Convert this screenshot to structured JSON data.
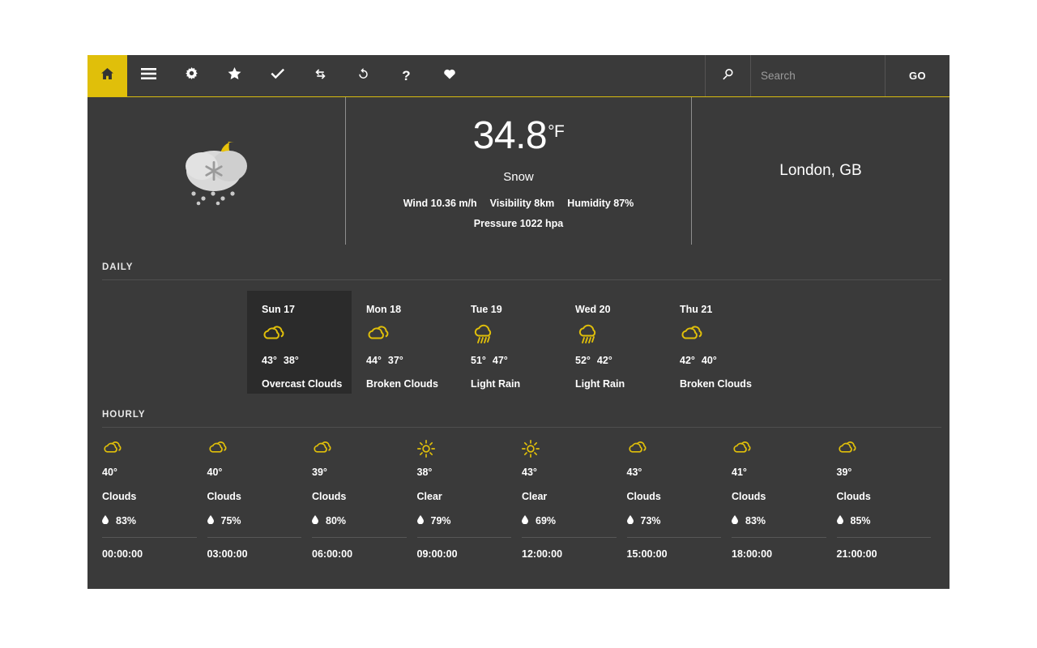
{
  "navbar": {
    "home_icon": "home-icon",
    "items": [
      {
        "name": "menu-icon",
        "glyph": "menu"
      },
      {
        "name": "settings-gear-icon",
        "glyph": "gear"
      },
      {
        "name": "favorite-star-icon",
        "glyph": "star"
      },
      {
        "name": "check-icon",
        "glyph": "check"
      },
      {
        "name": "sync-icon",
        "glyph": "sync"
      },
      {
        "name": "refresh-icon",
        "glyph": "refresh"
      },
      {
        "name": "help-icon",
        "glyph": "?"
      },
      {
        "name": "heart-icon",
        "glyph": "heart"
      }
    ],
    "search_icon": "search-icon",
    "search_placeholder": "Search",
    "search_value": "",
    "go_label": "GO",
    "accent_color": "#e0bf0a"
  },
  "current": {
    "icon": "night-snow-icon",
    "temperature": "34.8",
    "unit": "°F",
    "description": "Snow",
    "wind": "Wind 10.36 m/h",
    "visibility": "Visibility 8km",
    "humidity": "Humidity 87%",
    "pressure": "Pressure 1022 hpa",
    "location": "London, GB"
  },
  "daily": {
    "title": "DAILY",
    "cards": [
      {
        "day": "Sun 17",
        "icon": "clouds-icon",
        "high": "43°",
        "low": "38°",
        "desc": "Overcast Clouds",
        "selected": true
      },
      {
        "day": "Mon 18",
        "icon": "clouds-icon",
        "high": "44°",
        "low": "37°",
        "desc": "Broken Clouds",
        "selected": false
      },
      {
        "day": "Tue 19",
        "icon": "rain-icon",
        "high": "51°",
        "low": "47°",
        "desc": "Light Rain",
        "selected": false
      },
      {
        "day": "Wed 20",
        "icon": "rain-icon",
        "high": "52°",
        "low": "42°",
        "desc": "Light Rain",
        "selected": false
      },
      {
        "day": "Thu 21",
        "icon": "clouds-icon",
        "high": "42°",
        "low": "40°",
        "desc": "Broken Clouds",
        "selected": false
      }
    ]
  },
  "hourly": {
    "title": "HOURLY",
    "cards": [
      {
        "icon": "clouds-icon",
        "temp": "40°",
        "desc": "Clouds",
        "humidity": "83%",
        "time": "00:00:00"
      },
      {
        "icon": "clouds-icon",
        "temp": "40°",
        "desc": "Clouds",
        "humidity": "75%",
        "time": "03:00:00"
      },
      {
        "icon": "clouds-icon",
        "temp": "39°",
        "desc": "Clouds",
        "humidity": "80%",
        "time": "06:00:00"
      },
      {
        "icon": "sun-icon",
        "temp": "38°",
        "desc": "Clear",
        "humidity": "79%",
        "time": "09:00:00"
      },
      {
        "icon": "sun-icon",
        "temp": "43°",
        "desc": "Clear",
        "humidity": "69%",
        "time": "12:00:00"
      },
      {
        "icon": "clouds-icon",
        "temp": "43°",
        "desc": "Clouds",
        "humidity": "73%",
        "time": "15:00:00"
      },
      {
        "icon": "clouds-icon",
        "temp": "41°",
        "desc": "Clouds",
        "humidity": "83%",
        "time": "18:00:00"
      },
      {
        "icon": "clouds-icon",
        "temp": "39°",
        "desc": "Clouds",
        "humidity": "85%",
        "time": "21:00:00"
      }
    ]
  }
}
